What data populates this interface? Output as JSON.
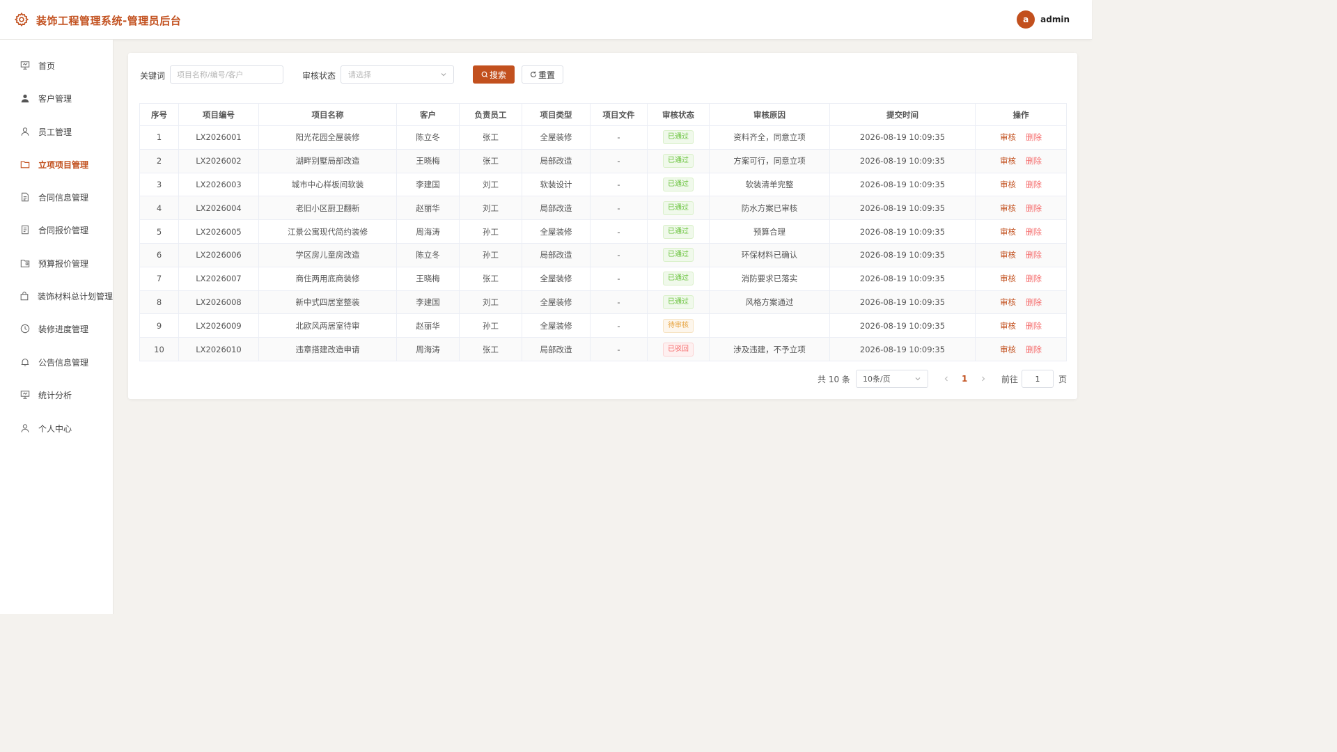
{
  "app": {
    "title": "装饰工程管理系统-管理员后台"
  },
  "user": {
    "avatar_letter": "a",
    "name": "admin"
  },
  "sidebar": {
    "items": [
      {
        "label": "首页",
        "icon": "dashboard-icon"
      },
      {
        "label": "客户管理",
        "icon": "user-filled-icon"
      },
      {
        "label": "员工管理",
        "icon": "user-icon"
      },
      {
        "label": "立项项目管理",
        "icon": "folder-icon",
        "active": true
      },
      {
        "label": "合同信息管理",
        "icon": "document-icon"
      },
      {
        "label": "合同报价管理",
        "icon": "tickets-icon"
      },
      {
        "label": "预算报价管理",
        "icon": "folder-box-icon"
      },
      {
        "label": "装饰材料总计划管理",
        "icon": "bag-icon"
      },
      {
        "label": "装修进度管理",
        "icon": "clock-icon"
      },
      {
        "label": "公告信息管理",
        "icon": "bell-icon"
      },
      {
        "label": "统计分析",
        "icon": "chart-icon"
      },
      {
        "label": "个人中心",
        "icon": "user-icon"
      }
    ]
  },
  "filters": {
    "keyword_label": "关键词",
    "keyword_value": "",
    "keyword_placeholder": "项目名称/编号/客户",
    "status_label": "审核状态",
    "status_placeholder": "请选择",
    "search_label": "搜索",
    "reset_label": "重置"
  },
  "table": {
    "columns": [
      "序号",
      "项目编号",
      "项目名称",
      "客户",
      "负责员工",
      "项目类型",
      "项目文件",
      "审核状态",
      "审核原因",
      "提交时间",
      "操作"
    ],
    "rows": [
      {
        "no": "1",
        "code": "LX2026001",
        "name": "阳光花园全屋装修",
        "customer": "陈立冬",
        "staff": "张工",
        "type": "全屋装修",
        "file": "-",
        "status": "已通过",
        "status_kind": "ok",
        "reason": "资料齐全，同意立项",
        "time": "2026-08-19 10:09:35"
      },
      {
        "no": "2",
        "code": "LX2026002",
        "name": "湖畔别墅局部改造",
        "customer": "王晓梅",
        "staff": "张工",
        "type": "局部改造",
        "file": "-",
        "status": "已通过",
        "status_kind": "ok",
        "reason": "方案可行，同意立项",
        "time": "2026-08-19 10:09:35"
      },
      {
        "no": "3",
        "code": "LX2026003",
        "name": "城市中心样板间软装",
        "customer": "李建国",
        "staff": "刘工",
        "type": "软装设计",
        "file": "-",
        "status": "已通过",
        "status_kind": "ok",
        "reason": "软装清单完整",
        "time": "2026-08-19 10:09:35"
      },
      {
        "no": "4",
        "code": "LX2026004",
        "name": "老旧小区厨卫翻新",
        "customer": "赵丽华",
        "staff": "刘工",
        "type": "局部改造",
        "file": "-",
        "status": "已通过",
        "status_kind": "ok",
        "reason": "防水方案已审核",
        "time": "2026-08-19 10:09:35"
      },
      {
        "no": "5",
        "code": "LX2026005",
        "name": "江景公寓现代简约装修",
        "customer": "周海涛",
        "staff": "孙工",
        "type": "全屋装修",
        "file": "-",
        "status": "已通过",
        "status_kind": "ok",
        "reason": "预算合理",
        "time": "2026-08-19 10:09:35"
      },
      {
        "no": "6",
        "code": "LX2026006",
        "name": "学区房儿童房改造",
        "customer": "陈立冬",
        "staff": "孙工",
        "type": "局部改造",
        "file": "-",
        "status": "已通过",
        "status_kind": "ok",
        "reason": "环保材料已确认",
        "time": "2026-08-19 10:09:35"
      },
      {
        "no": "7",
        "code": "LX2026007",
        "name": "商住两用底商装修",
        "customer": "王晓梅",
        "staff": "张工",
        "type": "全屋装修",
        "file": "-",
        "status": "已通过",
        "status_kind": "ok",
        "reason": "消防要求已落实",
        "time": "2026-08-19 10:09:35"
      },
      {
        "no": "8",
        "code": "LX2026008",
        "name": "新中式四居室整装",
        "customer": "李建国",
        "staff": "刘工",
        "type": "全屋装修",
        "file": "-",
        "status": "已通过",
        "status_kind": "ok",
        "reason": "风格方案通过",
        "time": "2026-08-19 10:09:35"
      },
      {
        "no": "9",
        "code": "LX2026009",
        "name": "北欧风两居室待审",
        "customer": "赵丽华",
        "staff": "孙工",
        "type": "全屋装修",
        "file": "-",
        "status": "待审核",
        "status_kind": "wait",
        "reason": "",
        "time": "2026-08-19 10:09:35"
      },
      {
        "no": "10",
        "code": "LX2026010",
        "name": "违章搭建改造申请",
        "customer": "周海涛",
        "staff": "张工",
        "type": "局部改造",
        "file": "-",
        "status": "已驳回",
        "status_kind": "rej",
        "reason": "涉及违建，不予立项",
        "time": "2026-08-19 10:09:35"
      }
    ],
    "actions": {
      "audit": "审核",
      "delete": "删除"
    }
  },
  "pagination": {
    "total_text": "共 10 条",
    "page_size": "10条/页",
    "current_page": "1",
    "goto_label": "前往",
    "goto_value": "1",
    "page_suffix": "页"
  },
  "colors": {
    "accent": "#c2501e",
    "success": "#67c23a",
    "warning": "#e6a23c",
    "danger": "#f56c6c"
  }
}
